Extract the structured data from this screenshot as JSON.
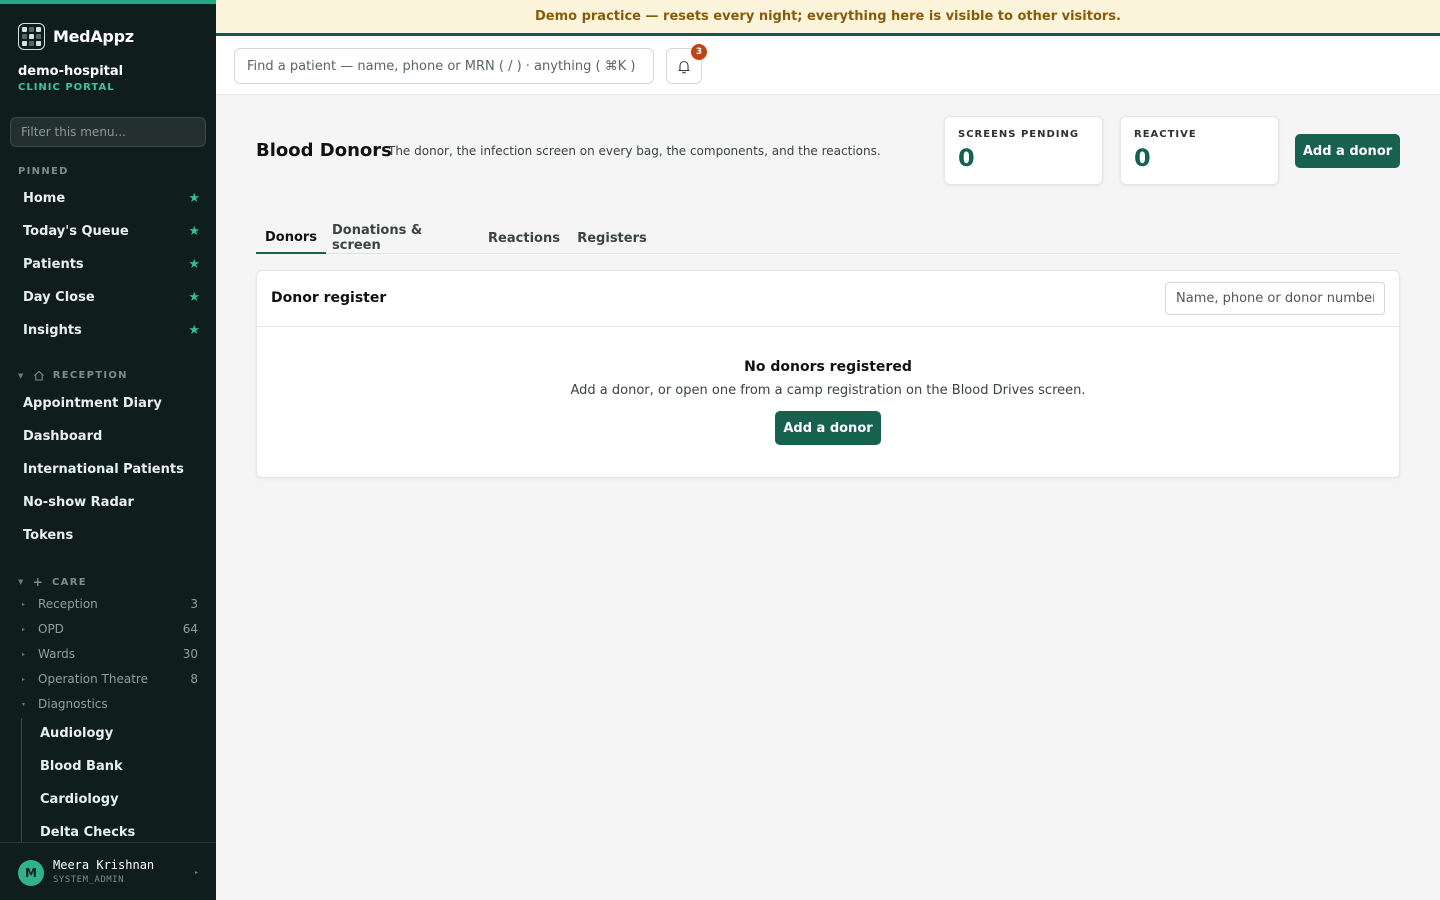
{
  "app": {
    "name": "MedAppz"
  },
  "tenant": {
    "name": "demo-hospital",
    "portal": "CLINIC PORTAL"
  },
  "sidebar": {
    "filter_placeholder": "Filter this menu...",
    "pinned_label": "PINNED",
    "pinned": [
      {
        "label": "Home"
      },
      {
        "label": "Today's Queue"
      },
      {
        "label": "Patients"
      },
      {
        "label": "Day Close"
      },
      {
        "label": "Insights"
      }
    ],
    "reception": {
      "label": "RECEPTION",
      "items": [
        {
          "label": "Appointment Diary"
        },
        {
          "label": "Dashboard"
        },
        {
          "label": "International Patients"
        },
        {
          "label": "No-show Radar"
        },
        {
          "label": "Tokens"
        }
      ]
    },
    "care": {
      "label": "CARE",
      "groups": [
        {
          "label": "Reception",
          "count": "3"
        },
        {
          "label": "OPD",
          "count": "64"
        },
        {
          "label": "Wards",
          "count": "30"
        },
        {
          "label": "Operation Theatre",
          "count": "8"
        },
        {
          "label": "Diagnostics",
          "count": ""
        }
      ],
      "diagnostics_items": [
        {
          "label": "Audiology"
        },
        {
          "label": "Blood Bank"
        },
        {
          "label": "Cardiology"
        },
        {
          "label": "Delta Checks"
        }
      ]
    }
  },
  "user": {
    "initial": "M",
    "name": "Meera Krishnan",
    "role": "SYSTEM_ADMIN"
  },
  "banner": {
    "text": "Demo practice — resets every night; everything here is visible to other visitors."
  },
  "topbar": {
    "search_placeholder": "Find a patient — name, phone or MRN ( / ) · anything ( ⌘K )",
    "notification_count": "3"
  },
  "page": {
    "title": "Blood Donors",
    "subtitle": "The donor, the infection screen on every bag, the components, and the reactions.",
    "stats": [
      {
        "label": "SCREENS PENDING",
        "value": "0"
      },
      {
        "label": "REACTIVE",
        "value": "0"
      }
    ],
    "add_button": "Add a donor"
  },
  "tabs": [
    {
      "label": "Donors",
      "active": true
    },
    {
      "label": "Donations & screen"
    },
    {
      "label": "Reactions"
    },
    {
      "label": "Registers"
    }
  ],
  "register": {
    "title": "Donor register",
    "search_placeholder": "Name, phone or donor number",
    "empty_title": "No donors registered",
    "empty_sub": "Add a donor, or open one from a camp registration on the Blood Drives screen.",
    "empty_button": "Add a donor"
  },
  "colors": {
    "accent": "#17624f",
    "sidebar_bg": "#0f1d1c",
    "star": "#32c08f",
    "banner_bg": "#fdf4dc",
    "banner_text": "#8a5a0b",
    "badge": "#c0440f"
  }
}
